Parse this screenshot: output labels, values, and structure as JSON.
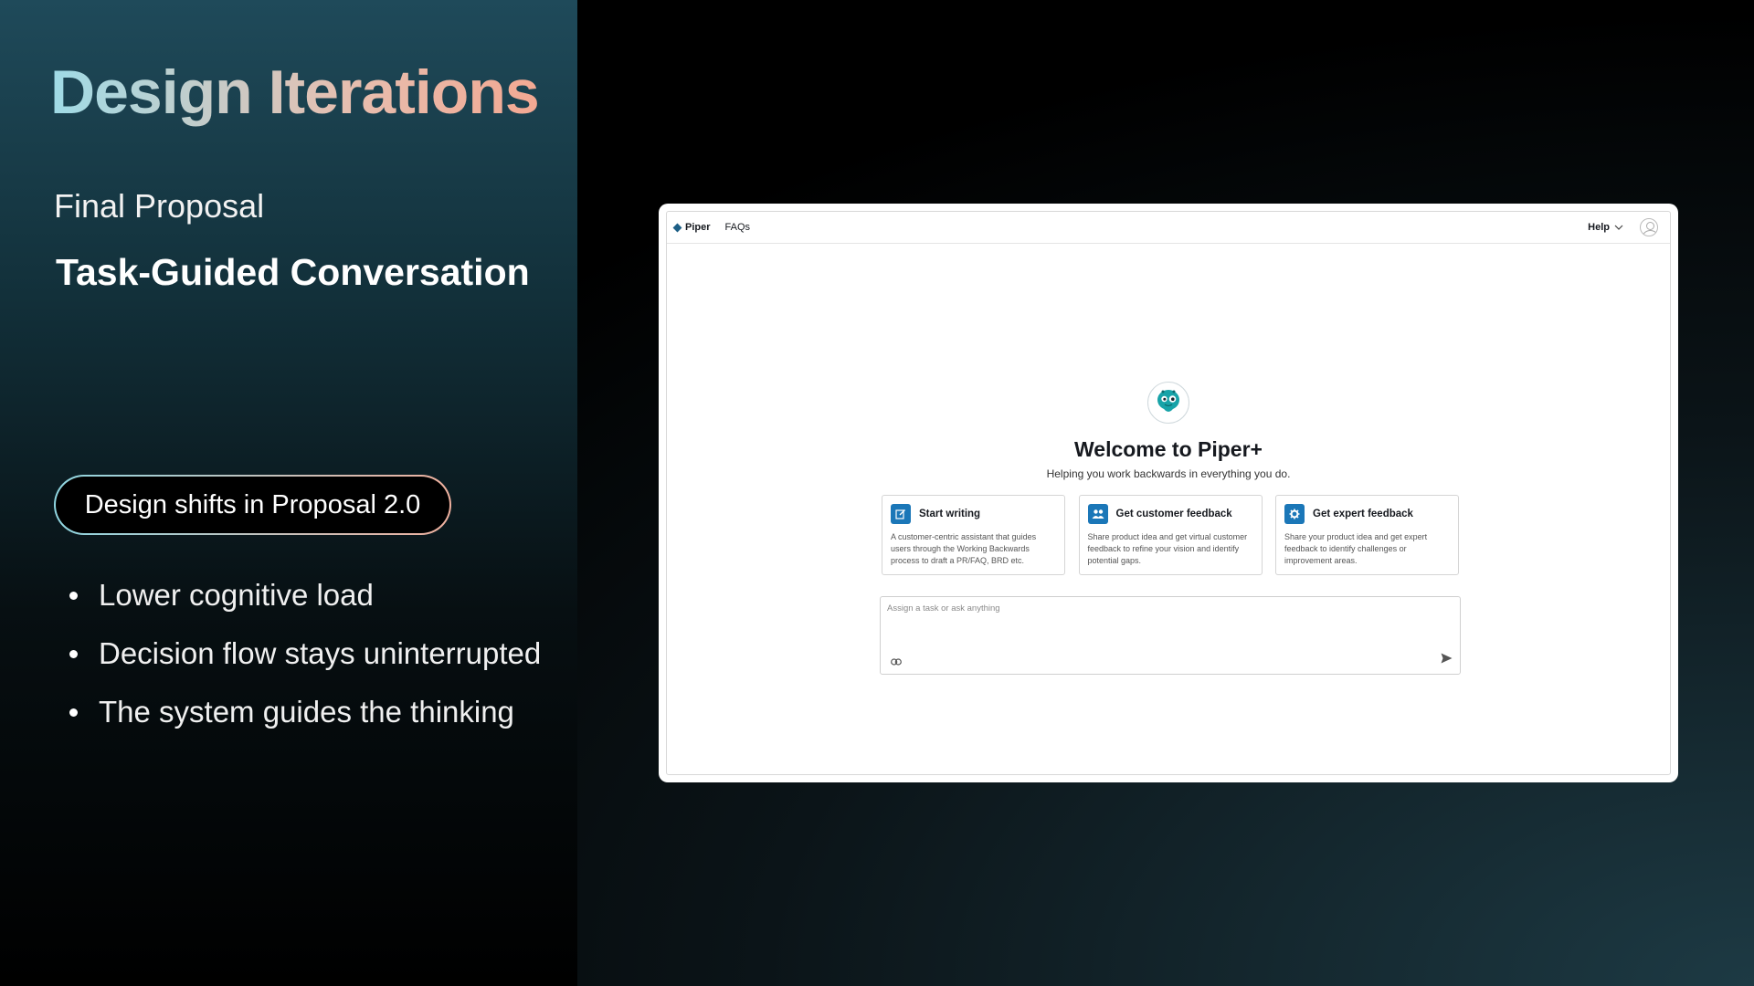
{
  "slide": {
    "title": "Design Iterations",
    "subtitle": "Final Proposal",
    "heading": "Task-Guided Conversation",
    "pill_label": "Design shifts in Proposal 2.0",
    "bullets": [
      "Lower cognitive load",
      "Decision flow stays uninterrupted",
      "The system guides the thinking"
    ],
    "colors": {
      "title_gradient_start": "#9fdbe6",
      "title_gradient_end": "#f3a892",
      "accent_blue": "#1b77b8"
    }
  },
  "app": {
    "nav": {
      "brand": "Piper",
      "faqs": "FAQs",
      "help": "Help"
    },
    "welcome_title": "Welcome to Piper+",
    "tagline": "Helping you work backwards in everything you do.",
    "cards": [
      {
        "icon": "edit-icon",
        "title": "Start writing",
        "description": "A customer-centric assistant that guides users through the Working Backwards process to draft a PR/FAQ, BRD etc."
      },
      {
        "icon": "people-icon",
        "title": "Get customer feedback",
        "description": "Share product idea and get virtual customer feedback to refine your vision and identify potential gaps."
      },
      {
        "icon": "gear-icon",
        "title": "Get expert feedback",
        "description": "Share your product idea and get expert feedback to identify challenges or improvement areas."
      }
    ],
    "prompt": {
      "placeholder": "Assign a task or ask anything",
      "value": ""
    }
  }
}
